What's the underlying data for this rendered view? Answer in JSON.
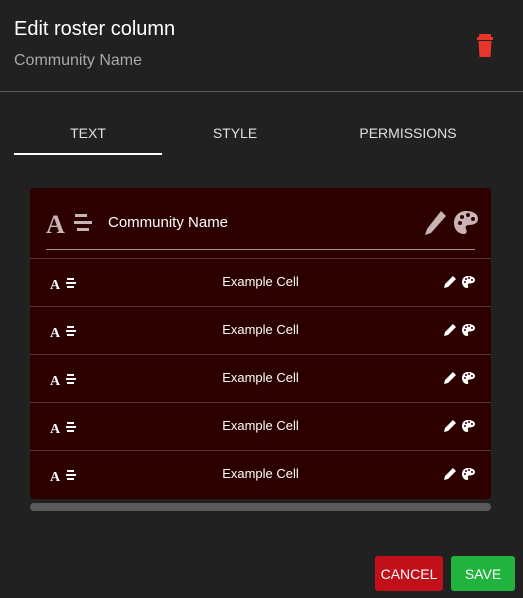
{
  "header": {
    "title": "Edit roster column",
    "subtitle": "Community Name",
    "delete_icon": "trash-icon"
  },
  "tabs": [
    {
      "label": "TEXT",
      "active": true
    },
    {
      "label": "STYLE",
      "active": false
    },
    {
      "label": "PERMISSIONS",
      "active": false
    }
  ],
  "preview": {
    "header_label": "Community Name",
    "rows": [
      {
        "cell": "Example Cell"
      },
      {
        "cell": "Example Cell"
      },
      {
        "cell": "Example Cell"
      },
      {
        "cell": "Example Cell"
      },
      {
        "cell": "Example Cell"
      }
    ],
    "icons": [
      "text-format-icon",
      "pencil-icon",
      "palette-icon"
    ]
  },
  "actions": {
    "cancel_label": "CANCEL",
    "save_label": "SAVE"
  },
  "colors": {
    "background": "#212121",
    "preview_background": "#2d0000",
    "delete": "#e8352b",
    "cancel": "#c2101b",
    "save": "#20b43f"
  }
}
